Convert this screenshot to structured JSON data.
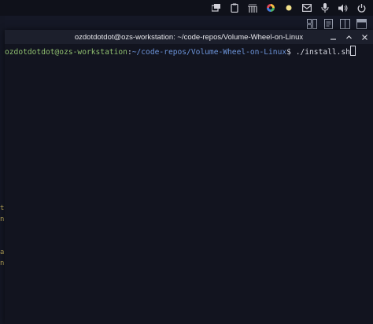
{
  "tray": {
    "icons": [
      "window-switcher-icon",
      "clipboard-icon",
      "network-activity-icon",
      "color-picker-icon",
      "notification-dot-icon",
      "mail-icon",
      "microphone-icon",
      "volume-icon",
      "power-icon"
    ]
  },
  "window": {
    "title": "ozdotdotdot@ozs-workstation: ~/code-repos/Volume-Wheel-on-Linux",
    "controls": [
      "minimize-icon",
      "maximize-icon",
      "close-icon"
    ]
  },
  "terminal": {
    "user_host": "ozdotdotdot@ozs-workstation",
    "separator": ":",
    "path": "~/code-repos/Volume-Wheel-on-Linux",
    "prompt_symbol": "$ ",
    "command": "./install.sh"
  },
  "background_fragments": [
    "t",
    "n",
    "",
    "",
    "a",
    "n"
  ],
  "colors": {
    "terminal_bg": "#12141f",
    "user_host": "#8fbf6f",
    "path": "#6c93d8",
    "text": "#d8dae3"
  }
}
